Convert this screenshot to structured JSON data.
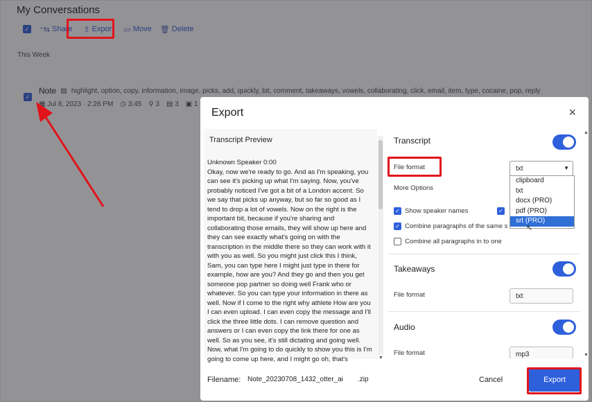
{
  "page": {
    "title": "My Conversations",
    "toolbar": {
      "share": "Share",
      "export": "Export",
      "move": "Move",
      "delete": "Delete"
    },
    "section": "This Week",
    "note": {
      "title": "Note",
      "keywords": "highlight, option, copy, information, image, picks, add, quickly, bit, comment, takeaways, vowels, collaborating, click, email, item, type, cocaine, pop, reply",
      "date": "Jul 8, 2023 · 2:26 PM",
      "duration": "3:45",
      "speakers": "3",
      "comments": "3",
      "images": "1"
    }
  },
  "dialog": {
    "title": "Export",
    "close_icon": "×",
    "preview": {
      "heading": "Transcript Preview",
      "speaker": "Unknown Speaker  0:00",
      "text": "Okay, now we're ready to go. And as I'm speaking, you can see it's picking up what I'm saying. Now, you've probably noticed I've got a bit of a London accent. So we say that picks up anyway, but so far so good as I tend to drop a lot of vowels. Now on the right is the important bit, because if you're sharing and collaborating those emails, they will show up here and they can see exactly what's going on with the transcription in the middle there so they can work with it with you as well. So you might just click this I think, Sam, you can type here I might just type in there for example, how are you? And they go and then you get someone pop partner so doing well Frank who or whatever. So you can type your information in there as well. Now if I come to the right why athlete How are you I can even upload. I can even copy the message and I'll click the three little dots. I can remove question and answers or I can even copy the link there for one as well. So as you see, it's still dictating and going well. Now, what I'm going to do quickly to show you this is I'm going to come up here, and I might go oh, that's"
    },
    "transcript": {
      "label": "Transcript",
      "file_format_label": "File format",
      "file_format_value": "txt",
      "more_options": "More Options",
      "options": [
        {
          "label": "Show speaker names",
          "checked": true
        },
        {
          "label": "Combine paragraphs of the same s",
          "checked": true
        },
        {
          "label": "Combine all paragraphs in to one",
          "checked": false
        }
      ],
      "dropdown_options": [
        "clipboard",
        "txt",
        "docx (PRO)",
        "pdf (PRO)",
        "srt (PRO)"
      ],
      "dropdown_selected": "srt (PRO)"
    },
    "takeaways": {
      "label": "Takeaways",
      "file_format_label": "File format",
      "file_format_value": "txt"
    },
    "audio": {
      "label": "Audio",
      "file_format_label": "File format",
      "file_format_value": "mp3"
    },
    "footer": {
      "filename_label": "Filename:",
      "filename_value": "Note_20230708_1432_otter_ai",
      "filename_ext": ".zip",
      "cancel": "Cancel",
      "export": "Export"
    }
  },
  "colors": {
    "accent": "#2e60dc",
    "highlight": "#e1141b"
  }
}
